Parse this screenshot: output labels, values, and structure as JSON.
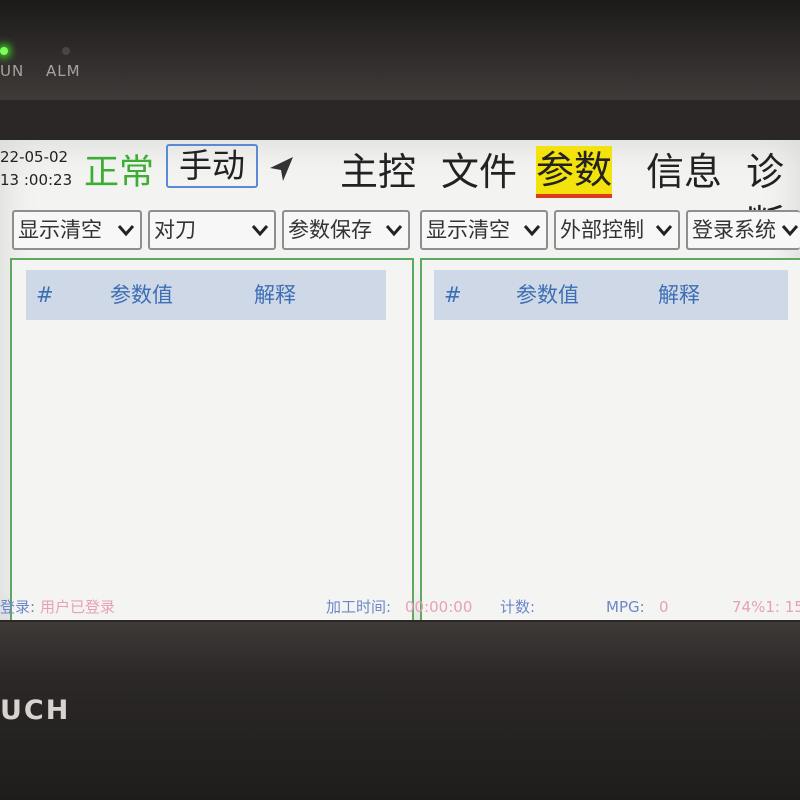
{
  "device": {
    "indicators": [
      {
        "label": "UN",
        "state": "on",
        "color": "#7dff5a"
      },
      {
        "label": "ALM",
        "state": "off",
        "color": "#4a4442"
      }
    ],
    "brand": "UCH"
  },
  "header": {
    "date": "22-05-02",
    "time": "13 :00:23",
    "status": "正常",
    "mode_button": "手动",
    "nav_icon": "navigation-arrow-icon",
    "tabs": [
      {
        "label": "主控",
        "active": false
      },
      {
        "label": "文件",
        "active": false
      },
      {
        "label": "参数",
        "active": true
      },
      {
        "label": "信息",
        "active": false
      },
      {
        "label": "诊断",
        "active": false
      }
    ]
  },
  "dropdowns": [
    {
      "value": "显示清空"
    },
    {
      "value": "对刀"
    },
    {
      "value": "参数保存"
    },
    {
      "value": "显示清空"
    },
    {
      "value": "外部控制"
    },
    {
      "value": "登录系统"
    }
  ],
  "panels": [
    {
      "columns": [
        "#",
        "参数值",
        "解释"
      ],
      "rows": []
    },
    {
      "columns": [
        "#",
        "参数值",
        "解释"
      ],
      "rows": []
    }
  ],
  "statusbar": {
    "login_label": "登录:",
    "login_value": "用户已登录",
    "time_label": "加工时间:",
    "time_value": "00:00:00",
    "count_label": "计数:",
    "mpg_label": "MPG:",
    "mpg_value": "0",
    "tail": "74%1: 15"
  },
  "colors": {
    "status_normal": "#3cae33",
    "active_tab": "#f4e20c",
    "active_tab_underline": "#e0391d",
    "panel_border": "#5fa860",
    "table_header_bg": "#cfd8e6",
    "table_header_text": "#3d6fb5"
  }
}
